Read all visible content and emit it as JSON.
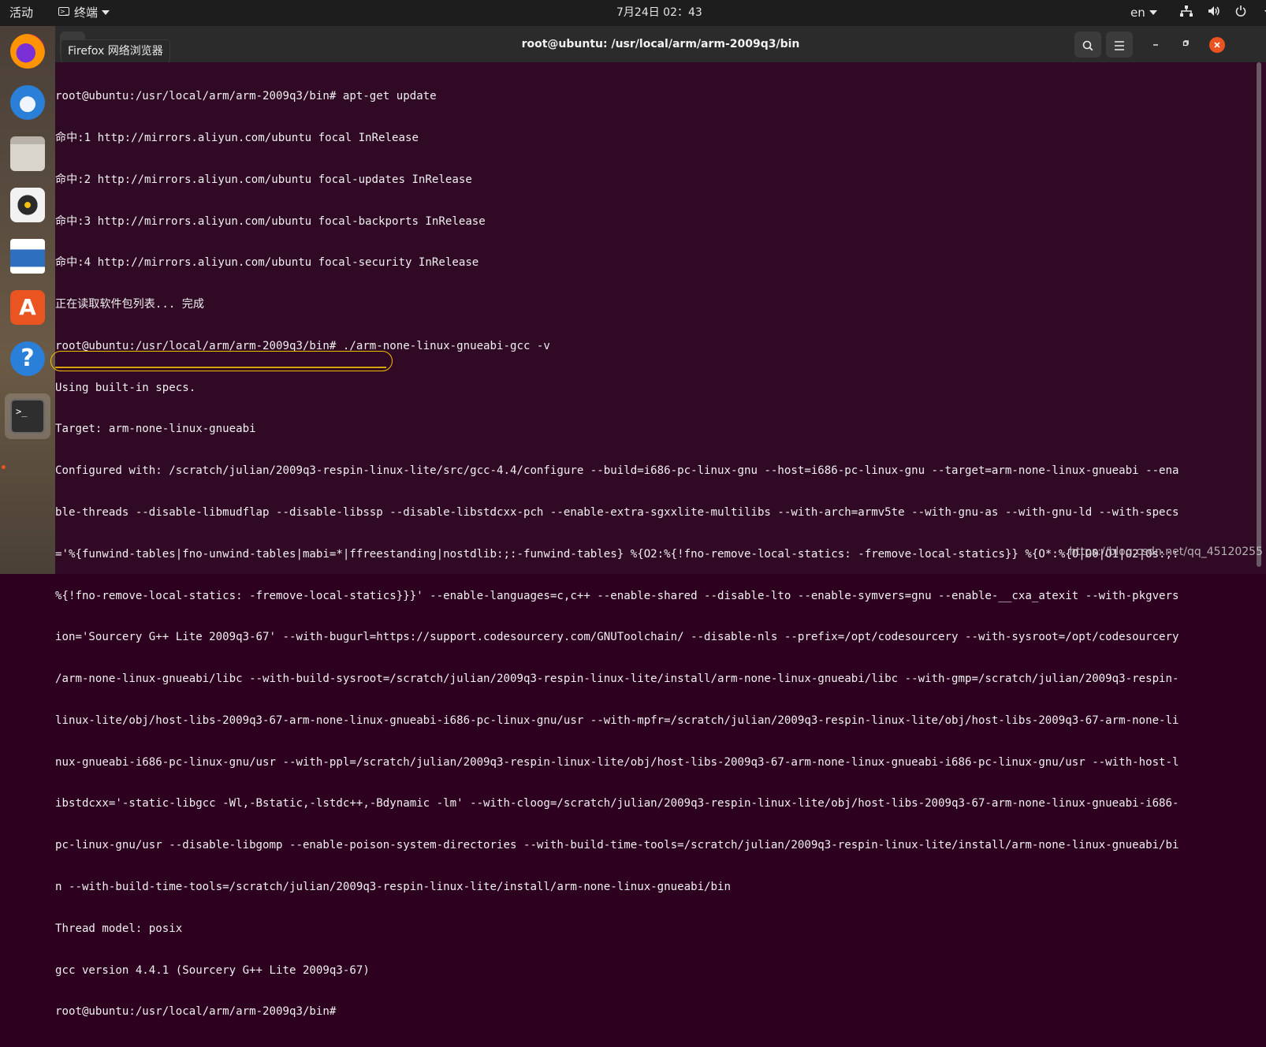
{
  "top_bar": {
    "activities": "活动",
    "app_name": "终端",
    "clock": "7月24日  02：43",
    "language": "en"
  },
  "tooltip": "Firefox 网络浏览器",
  "window": {
    "title": "root@ubuntu: /usr/local/arm/arm-2009q3/bin"
  },
  "terminal_lines": [
    "root@ubuntu:/usr/local/arm/arm-2009q3/bin# apt-get update",
    "命中:1 http://mirrors.aliyun.com/ubuntu focal InRelease",
    "命中:2 http://mirrors.aliyun.com/ubuntu focal-updates InRelease",
    "命中:3 http://mirrors.aliyun.com/ubuntu focal-backports InRelease",
    "命中:4 http://mirrors.aliyun.com/ubuntu focal-security InRelease",
    "正在读取软件包列表... 完成",
    "root@ubuntu:/usr/local/arm/arm-2009q3/bin# ./arm-none-linux-gnueabi-gcc -v",
    "Using built-in specs.",
    "Target: arm-none-linux-gnueabi",
    "Configured with: /scratch/julian/2009q3-respin-linux-lite/src/gcc-4.4/configure --build=i686-pc-linux-gnu --host=i686-pc-linux-gnu --target=arm-none-linux-gnueabi --ena",
    "ble-threads --disable-libmudflap --disable-libssp --disable-libstdcxx-pch --enable-extra-sgxxlite-multilibs --with-arch=armv5te --with-gnu-as --with-gnu-ld --with-specs",
    "='%{funwind-tables|fno-unwind-tables|mabi=*|ffreestanding|nostdlib:;:-funwind-tables} %{O2:%{!fno-remove-local-statics: -fremove-local-statics}} %{O*:%{O|O0|O1|O2|Os:;:",
    "%{!fno-remove-local-statics: -fremove-local-statics}}}' --enable-languages=c,c++ --enable-shared --disable-lto --enable-symvers=gnu --enable-__cxa_atexit --with-pkgvers",
    "ion='Sourcery G++ Lite 2009q3-67' --with-bugurl=https://support.codesourcery.com/GNUToolchain/ --disable-nls --prefix=/opt/codesourcery --with-sysroot=/opt/codesourcery",
    "/arm-none-linux-gnueabi/libc --with-build-sysroot=/scratch/julian/2009q3-respin-linux-lite/install/arm-none-linux-gnueabi/libc --with-gmp=/scratch/julian/2009q3-respin-",
    "linux-lite/obj/host-libs-2009q3-67-arm-none-linux-gnueabi-i686-pc-linux-gnu/usr --with-mpfr=/scratch/julian/2009q3-respin-linux-lite/obj/host-libs-2009q3-67-arm-none-li",
    "nux-gnueabi-i686-pc-linux-gnu/usr --with-ppl=/scratch/julian/2009q3-respin-linux-lite/obj/host-libs-2009q3-67-arm-none-linux-gnueabi-i686-pc-linux-gnu/usr --with-host-l",
    "ibstdcxx='-static-libgcc -Wl,-Bstatic,-lstdc++,-Bdynamic -lm' --with-cloog=/scratch/julian/2009q3-respin-linux-lite/obj/host-libs-2009q3-67-arm-none-linux-gnueabi-i686-",
    "pc-linux-gnu/usr --disable-libgomp --enable-poison-system-directories --with-build-time-tools=/scratch/julian/2009q3-respin-linux-lite/install/arm-none-linux-gnueabi/bi",
    "n --with-build-time-tools=/scratch/julian/2009q3-respin-linux-lite/install/arm-none-linux-gnueabi/bin",
    "Thread model: posix",
    "gcc version 4.4.1 (Sourcery G++ Lite 2009q3-67)",
    "root@ubuntu:/usr/local/arm/arm-2009q3/bin# "
  ],
  "watermark": "https://blog.csdn.net/qq_45120255",
  "colors": {
    "terminal_bg": "#300a24",
    "accent": "#e95420",
    "highlight": "#f0c000"
  },
  "dock_icons": [
    "firefox-icon",
    "thunderbird-icon",
    "files-icon",
    "rhythmbox-icon",
    "writer-icon",
    "software-center-icon",
    "help-icon",
    "terminal-icon"
  ]
}
